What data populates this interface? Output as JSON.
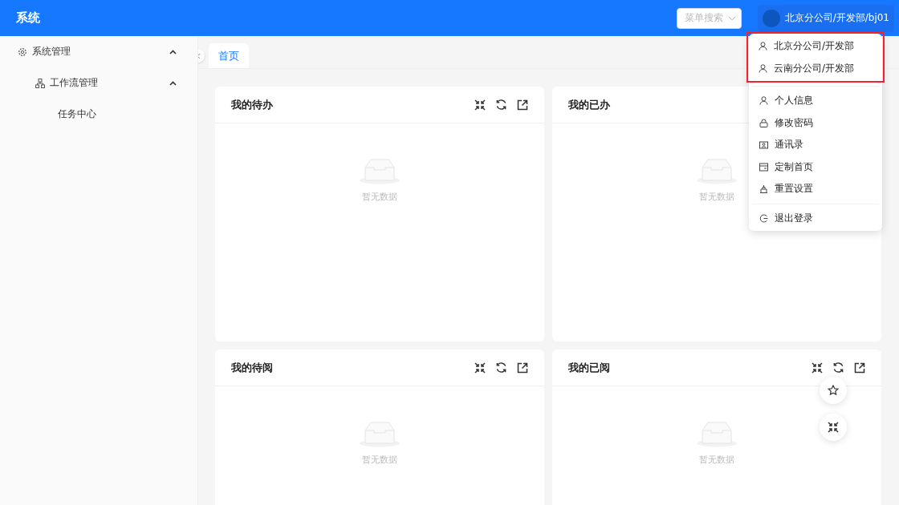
{
  "header": {
    "title": "系统",
    "search": {
      "placeholder": "菜单搜索"
    },
    "user": {
      "name": "北京分公司/开发部/bj01"
    }
  },
  "sidebar": {
    "items": [
      {
        "label": "系统管理",
        "expanded": true,
        "children": [
          {
            "label": "工作流管理",
            "expanded": true,
            "children": [
              {
                "label": "任务中心"
              }
            ]
          }
        ]
      }
    ]
  },
  "tabs": [
    {
      "label": "首页",
      "selected": true
    }
  ],
  "cards": [
    {
      "title": "我的待办",
      "empty_text": "暂无数据"
    },
    {
      "title": "我的已办",
      "empty_text": "暂无数据"
    },
    {
      "title": "我的待阅",
      "empty_text": "暂无数据"
    },
    {
      "title": "我的已阅",
      "empty_text": "暂无数据"
    }
  ],
  "user_menu": {
    "orgs": [
      {
        "label": "北京分公司/开发部"
      },
      {
        "label": "云南分公司/开发部"
      }
    ],
    "actions": [
      {
        "label": "个人信息"
      },
      {
        "label": "修改密码"
      },
      {
        "label": "通讯录"
      },
      {
        "label": "定制首页"
      },
      {
        "label": "重置设置"
      }
    ],
    "logout": {
      "label": "退出登录"
    }
  }
}
